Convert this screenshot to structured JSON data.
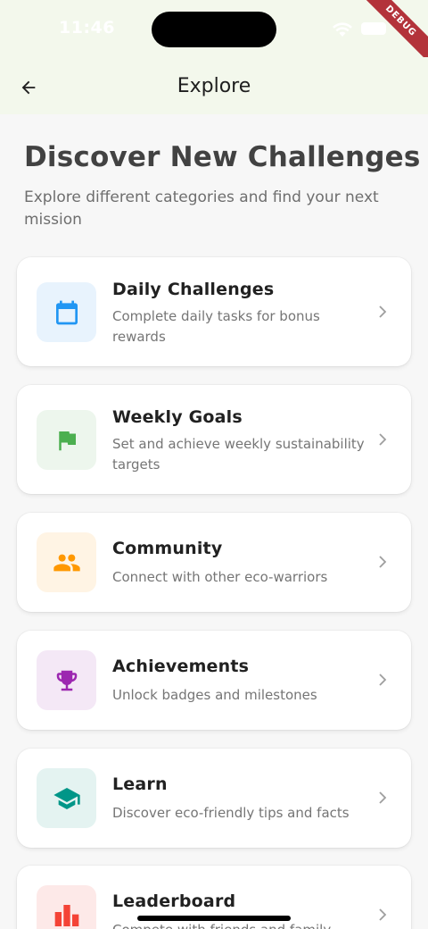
{
  "status_bar": {
    "time": "11:46"
  },
  "debug_banner": "DEBUG",
  "app_bar": {
    "title": "Explore"
  },
  "page": {
    "heading": "Discover New Challenges",
    "subheading": "Explore different categories and find your next mission"
  },
  "categories": [
    {
      "title": "Daily Challenges",
      "description": "Complete daily tasks for bonus rewards",
      "icon": "calendar-icon",
      "icon_color": "#2196f3",
      "bg_color": "#e8f3fd"
    },
    {
      "title": "Weekly Goals",
      "description": "Set and achieve weekly sustainability targets",
      "icon": "flag-icon",
      "icon_color": "#4caf50",
      "bg_color": "#edf6ed"
    },
    {
      "title": "Community",
      "description": "Connect with other eco-warriors",
      "icon": "people-icon",
      "icon_color": "#ff9800",
      "bg_color": "#fff4e4"
    },
    {
      "title": "Achievements",
      "description": "Unlock badges and milestones",
      "icon": "trophy-icon",
      "icon_color": "#9c27b0",
      "bg_color": "#f4e8f6"
    },
    {
      "title": "Learn",
      "description": "Discover eco-friendly tips and facts",
      "icon": "school-icon",
      "icon_color": "#009688",
      "bg_color": "#e4f3f1"
    },
    {
      "title": "Leaderboard",
      "description": "Compete with friends and family",
      "icon": "leaderboard-icon",
      "icon_color": "#f44336",
      "bg_color": "#fde9e8"
    }
  ]
}
